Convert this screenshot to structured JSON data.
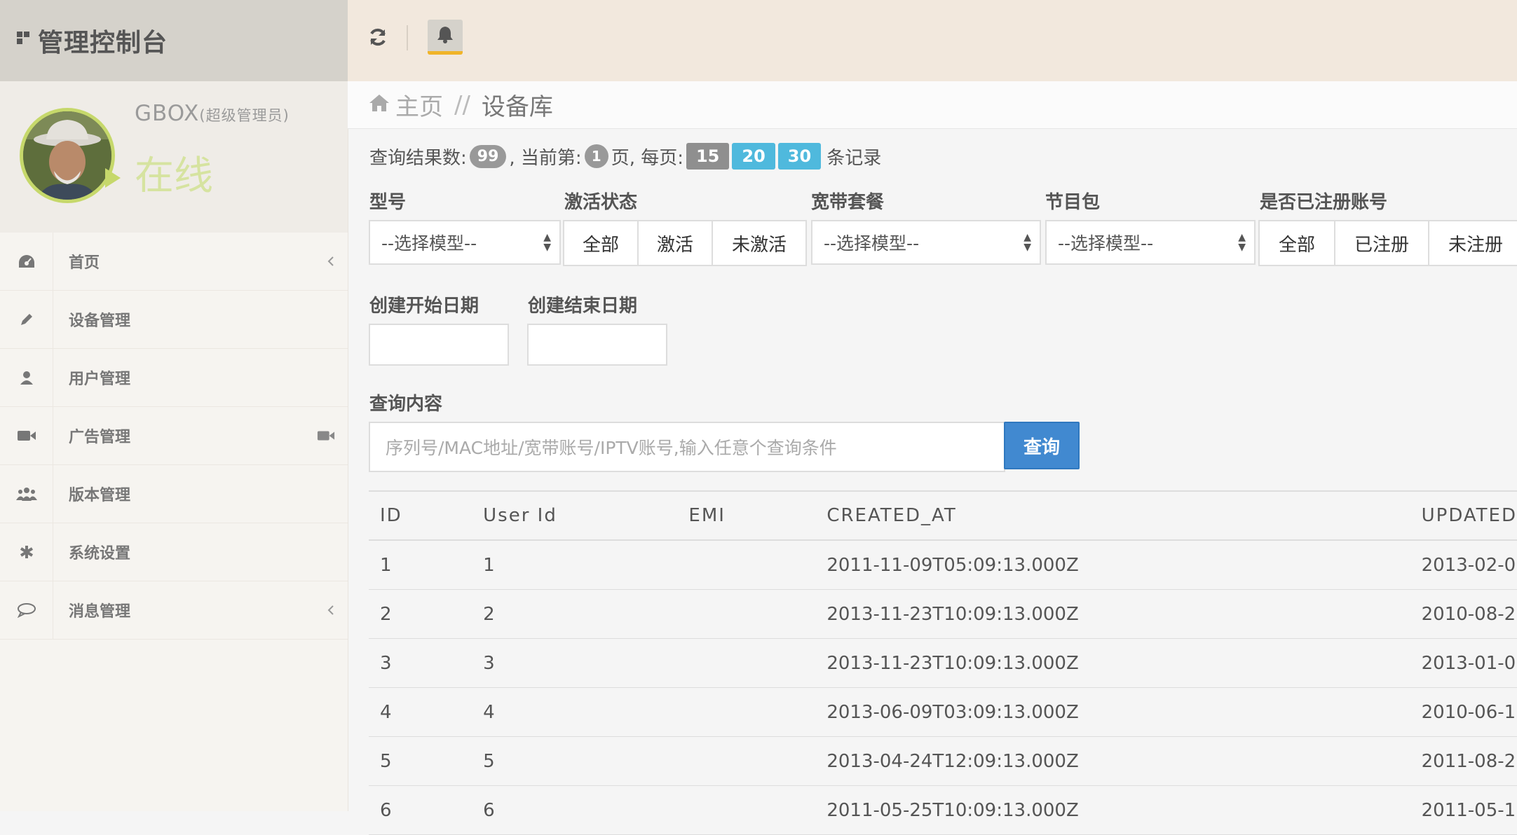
{
  "brand": {
    "title": "管理控制台"
  },
  "profile": {
    "name": "GBOX",
    "role": "(超级管理员)",
    "status": "在线"
  },
  "sidebar": {
    "items": [
      {
        "label": "首页",
        "icon": "dashboard-icon"
      },
      {
        "label": "设备管理",
        "icon": "pencil-icon"
      },
      {
        "label": "用户管理",
        "icon": "user-icon"
      },
      {
        "label": "广告管理",
        "icon": "video-camera-icon"
      },
      {
        "label": "版本管理",
        "icon": "users-icon"
      },
      {
        "label": "系统设置",
        "icon": "asterisk-icon"
      },
      {
        "label": "消息管理",
        "icon": "comment-icon"
      }
    ]
  },
  "topbar": {
    "refresh_icon": "refresh-icon",
    "bell_icon": "bell-icon"
  },
  "breadcrumb": {
    "home": "主页",
    "separator": "//",
    "current": "设备库"
  },
  "summary": {
    "prefix": "查询结果数:",
    "total": "99",
    "current_prefix": ", 当前第:",
    "page": "1",
    "page_suffix": "页, 每页:",
    "sizes": [
      "15",
      "20",
      "30"
    ],
    "suffix": "条记录"
  },
  "filters": {
    "model": {
      "label": "型号",
      "value": "--选择模型--"
    },
    "activation": {
      "label": "激活状态",
      "options": [
        "全部",
        "激活",
        "未激活"
      ]
    },
    "broadband": {
      "label": "宽带套餐",
      "value": "--选择模型--"
    },
    "package": {
      "label": "节目包",
      "value": "--选择模型--"
    },
    "registered": {
      "label": "是否已注册账号",
      "options": [
        "全部",
        "已注册",
        "未注册"
      ]
    },
    "start_date": {
      "label": "创建开始日期",
      "value": ""
    },
    "end_date": {
      "label": "创建结束日期",
      "value": ""
    }
  },
  "search": {
    "label": "查询内容",
    "placeholder": "序列号/MAC地址/宽带账号/IPTV账号,输入任意个查询条件",
    "button": "查询"
  },
  "table": {
    "headers": [
      "ID",
      "User Id",
      "EMI",
      "CREATED_AT",
      "UPDATED"
    ],
    "rows": [
      [
        "1",
        "1",
        "",
        "2011-11-09T05:09:13.000Z",
        "2013-02-0"
      ],
      [
        "2",
        "2",
        "",
        "2013-11-23T10:09:13.000Z",
        "2010-08-2"
      ],
      [
        "3",
        "3",
        "",
        "2013-11-23T10:09:13.000Z",
        "2013-01-0"
      ],
      [
        "4",
        "4",
        "",
        "2013-06-09T03:09:13.000Z",
        "2010-06-1"
      ],
      [
        "5",
        "5",
        "",
        "2013-04-24T12:09:13.000Z",
        "2011-08-2"
      ],
      [
        "6",
        "6",
        "",
        "2011-05-25T10:09:13.000Z",
        "2011-05-1"
      ]
    ]
  },
  "colors": {
    "accent": "#4189d0",
    "status_online": "#d6e3a0",
    "page_size_active": "#4fb9dd"
  }
}
